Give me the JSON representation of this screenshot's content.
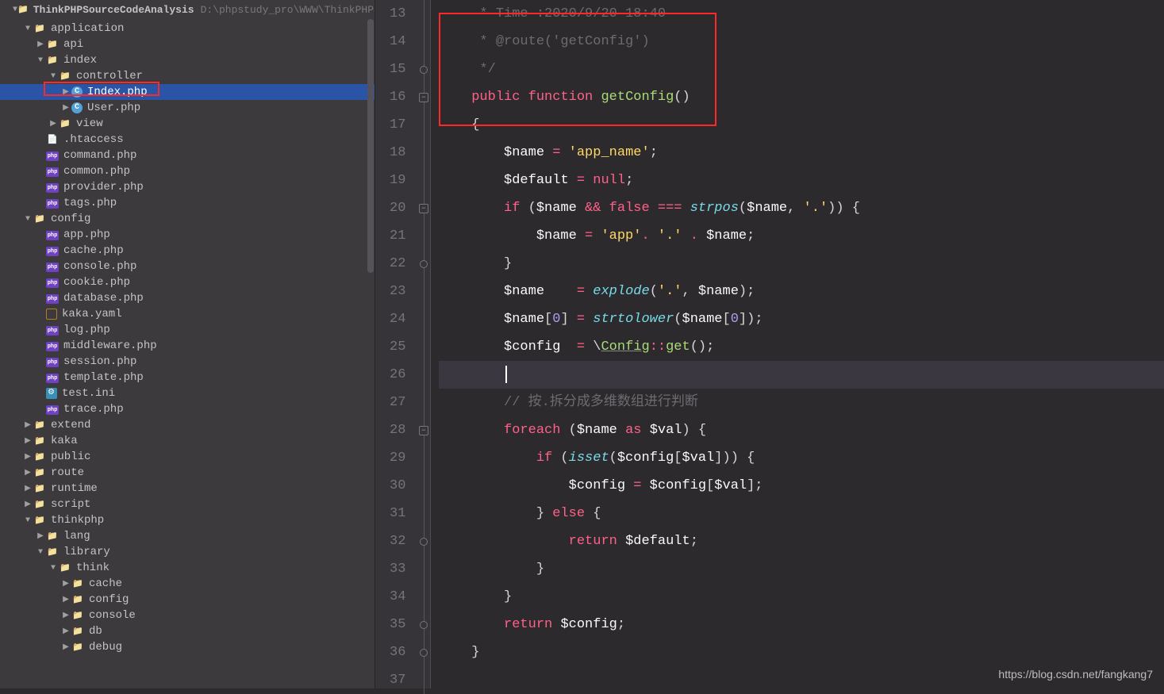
{
  "project": {
    "name": "ThinkPHPSourceCodeAnalysis",
    "path": "D:\\phpstudy_pro\\WWW\\ThinkPHPSourceCo"
  },
  "tree": [
    {
      "d": 1,
      "a": "d",
      "i": "folder",
      "t": "application"
    },
    {
      "d": 2,
      "a": "r",
      "i": "folder",
      "t": "api"
    },
    {
      "d": 2,
      "a": "d",
      "i": "folder",
      "t": "index"
    },
    {
      "d": 3,
      "a": "d",
      "i": "folder",
      "t": "controller"
    },
    {
      "d": 4,
      "a": "r",
      "i": "class",
      "t": "Index.php",
      "sel": true
    },
    {
      "d": 4,
      "a": "r",
      "i": "class",
      "t": "User.php"
    },
    {
      "d": 3,
      "a": "r",
      "i": "folder",
      "t": "view"
    },
    {
      "d": 2,
      "a": "n",
      "i": "file",
      "t": ".htaccess"
    },
    {
      "d": 2,
      "a": "n",
      "i": "php",
      "t": "command.php"
    },
    {
      "d": 2,
      "a": "n",
      "i": "php",
      "t": "common.php"
    },
    {
      "d": 2,
      "a": "n",
      "i": "php",
      "t": "provider.php"
    },
    {
      "d": 2,
      "a": "n",
      "i": "php",
      "t": "tags.php"
    },
    {
      "d": 1,
      "a": "d",
      "i": "folder",
      "t": "config"
    },
    {
      "d": 2,
      "a": "n",
      "i": "php",
      "t": "app.php"
    },
    {
      "d": 2,
      "a": "n",
      "i": "php",
      "t": "cache.php"
    },
    {
      "d": 2,
      "a": "n",
      "i": "php",
      "t": "console.php"
    },
    {
      "d": 2,
      "a": "n",
      "i": "php",
      "t": "cookie.php"
    },
    {
      "d": 2,
      "a": "n",
      "i": "php",
      "t": "database.php"
    },
    {
      "d": 2,
      "a": "n",
      "i": "yaml",
      "t": "kaka.yaml"
    },
    {
      "d": 2,
      "a": "n",
      "i": "php",
      "t": "log.php"
    },
    {
      "d": 2,
      "a": "n",
      "i": "php",
      "t": "middleware.php"
    },
    {
      "d": 2,
      "a": "n",
      "i": "php",
      "t": "session.php"
    },
    {
      "d": 2,
      "a": "n",
      "i": "php",
      "t": "template.php"
    },
    {
      "d": 2,
      "a": "n",
      "i": "ini",
      "t": "test.ini"
    },
    {
      "d": 2,
      "a": "n",
      "i": "php",
      "t": "trace.php"
    },
    {
      "d": 1,
      "a": "r",
      "i": "folder",
      "t": "extend"
    },
    {
      "d": 1,
      "a": "r",
      "i": "folder",
      "t": "kaka"
    },
    {
      "d": 1,
      "a": "r",
      "i": "folder",
      "t": "public"
    },
    {
      "d": 1,
      "a": "r",
      "i": "folder",
      "t": "route"
    },
    {
      "d": 1,
      "a": "r",
      "i": "folder",
      "t": "runtime"
    },
    {
      "d": 1,
      "a": "r",
      "i": "folder",
      "t": "script"
    },
    {
      "d": 1,
      "a": "d",
      "i": "folder",
      "t": "thinkphp"
    },
    {
      "d": 2,
      "a": "r",
      "i": "folder",
      "t": "lang"
    },
    {
      "d": 2,
      "a": "d",
      "i": "folder",
      "t": "library"
    },
    {
      "d": 3,
      "a": "d",
      "i": "folder",
      "t": "think"
    },
    {
      "d": 4,
      "a": "r",
      "i": "folder",
      "t": "cache"
    },
    {
      "d": 4,
      "a": "r",
      "i": "folder",
      "t": "config"
    },
    {
      "d": 4,
      "a": "r",
      "i": "folder",
      "t": "console"
    },
    {
      "d": 4,
      "a": "r",
      "i": "folder",
      "t": "db"
    },
    {
      "d": 4,
      "a": "r",
      "i": "folder",
      "t": "debug"
    }
  ],
  "lines": [
    13,
    14,
    15,
    16,
    17,
    18,
    19,
    20,
    21,
    22,
    23,
    24,
    25,
    26,
    27,
    28,
    29,
    30,
    31,
    32,
    33,
    34,
    35,
    36,
    37
  ],
  "fold": [
    "",
    "",
    "e",
    "m",
    "",
    "",
    "",
    "m",
    "",
    "e",
    "",
    "",
    "",
    "",
    "",
    "m",
    "",
    "",
    "",
    "e",
    "",
    "",
    "e",
    "e",
    ""
  ],
  "code": [
    {
      "tokens": [
        [
          "cm",
          "     * Time :2020/9/20 18:40"
        ]
      ]
    },
    {
      "tokens": [
        [
          "cm",
          "     * @route('getConfig')"
        ]
      ]
    },
    {
      "tokens": [
        [
          "cm",
          "     */"
        ]
      ]
    },
    {
      "tokens": [
        [
          "pn",
          "    "
        ],
        [
          "kw",
          "public"
        ],
        [
          "pn",
          " "
        ],
        [
          "kw",
          "function"
        ],
        [
          "pn",
          " "
        ],
        [
          "fn",
          "getConfig"
        ],
        [
          "pn",
          "()"
        ]
      ]
    },
    {
      "tokens": [
        [
          "pn",
          "    {"
        ]
      ]
    },
    {
      "tokens": [
        [
          "pn",
          "        "
        ],
        [
          "var",
          "$name"
        ],
        [
          "pn",
          " "
        ],
        [
          "op",
          "="
        ],
        [
          "pn",
          " "
        ],
        [
          "str",
          "'app_name'"
        ],
        [
          "pn",
          ";"
        ]
      ]
    },
    {
      "tokens": [
        [
          "pn",
          "        "
        ],
        [
          "var",
          "$default"
        ],
        [
          "pn",
          " "
        ],
        [
          "op",
          "="
        ],
        [
          "pn",
          " "
        ],
        [
          "kw",
          "null"
        ],
        [
          "pn",
          ";"
        ]
      ]
    },
    {
      "tokens": [
        [
          "pn",
          "        "
        ],
        [
          "kw",
          "if"
        ],
        [
          "pn",
          " ("
        ],
        [
          "var",
          "$name"
        ],
        [
          "pn",
          " "
        ],
        [
          "op",
          "&&"
        ],
        [
          "pn",
          " "
        ],
        [
          "kw",
          "false"
        ],
        [
          "pn",
          " "
        ],
        [
          "op",
          "==="
        ],
        [
          "pn",
          " "
        ],
        [
          "builtin",
          "strpos"
        ],
        [
          "pn",
          "("
        ],
        [
          "var",
          "$name"
        ],
        [
          "pn",
          ", "
        ],
        [
          "str",
          "'.'"
        ],
        [
          "pn",
          ")) {"
        ]
      ]
    },
    {
      "tokens": [
        [
          "pn",
          "            "
        ],
        [
          "var",
          "$name"
        ],
        [
          "pn",
          " "
        ],
        [
          "op",
          "="
        ],
        [
          "pn",
          " "
        ],
        [
          "str",
          "'app'"
        ],
        [
          "op",
          "."
        ],
        [
          "pn",
          " "
        ],
        [
          "str",
          "'.'"
        ],
        [
          "pn",
          " "
        ],
        [
          "op",
          "."
        ],
        [
          "pn",
          " "
        ],
        [
          "var",
          "$name"
        ],
        [
          "pn",
          ";"
        ]
      ]
    },
    {
      "tokens": [
        [
          "pn",
          "        }"
        ]
      ]
    },
    {
      "tokens": [
        [
          "pn",
          "        "
        ],
        [
          "var",
          "$name"
        ],
        [
          "pn",
          "    "
        ],
        [
          "op",
          "="
        ],
        [
          "pn",
          " "
        ],
        [
          "builtin",
          "explode"
        ],
        [
          "pn",
          "("
        ],
        [
          "str",
          "'.'"
        ],
        [
          "pn",
          ", "
        ],
        [
          "var",
          "$name"
        ],
        [
          "pn",
          ");"
        ]
      ]
    },
    {
      "tokens": [
        [
          "pn",
          "        "
        ],
        [
          "var",
          "$name"
        ],
        [
          "pn",
          "["
        ],
        [
          "num",
          "0"
        ],
        [
          "pn",
          "] "
        ],
        [
          "op",
          "="
        ],
        [
          "pn",
          " "
        ],
        [
          "builtin",
          "strtolower"
        ],
        [
          "pn",
          "("
        ],
        [
          "var",
          "$name"
        ],
        [
          "pn",
          "["
        ],
        [
          "num",
          "0"
        ],
        [
          "pn",
          "]);"
        ]
      ]
    },
    {
      "tokens": [
        [
          "pn",
          "        "
        ],
        [
          "var",
          "$config"
        ],
        [
          "pn",
          "  "
        ],
        [
          "op",
          "="
        ],
        [
          "pn",
          " \\"
        ],
        [
          "fn underline",
          "Config"
        ],
        [
          "op",
          "::"
        ],
        [
          "fn",
          "get"
        ],
        [
          "pn",
          "();"
        ]
      ]
    },
    {
      "tokens": [
        [
          "pn",
          "        "
        ]
      ],
      "current": true,
      "caret": true
    },
    {
      "tokens": [
        [
          "pn",
          "        "
        ],
        [
          "cm",
          "// 按.拆分成多维数组进行判断"
        ]
      ]
    },
    {
      "tokens": [
        [
          "pn",
          "        "
        ],
        [
          "kw",
          "foreach"
        ],
        [
          "pn",
          " ("
        ],
        [
          "var",
          "$name"
        ],
        [
          "pn",
          " "
        ],
        [
          "kw",
          "as"
        ],
        [
          "pn",
          " "
        ],
        [
          "var",
          "$val"
        ],
        [
          "pn",
          ") {"
        ]
      ]
    },
    {
      "tokens": [
        [
          "pn",
          "            "
        ],
        [
          "kw",
          "if"
        ],
        [
          "pn",
          " ("
        ],
        [
          "builtin",
          "isset"
        ],
        [
          "pn",
          "("
        ],
        [
          "var",
          "$config"
        ],
        [
          "pn",
          "["
        ],
        [
          "var",
          "$val"
        ],
        [
          "pn",
          "])) {"
        ]
      ]
    },
    {
      "tokens": [
        [
          "pn",
          "                "
        ],
        [
          "var",
          "$config"
        ],
        [
          "pn",
          " "
        ],
        [
          "op",
          "="
        ],
        [
          "pn",
          " "
        ],
        [
          "var",
          "$config"
        ],
        [
          "pn",
          "["
        ],
        [
          "var",
          "$val"
        ],
        [
          "pn",
          "];"
        ]
      ]
    },
    {
      "tokens": [
        [
          "pn",
          "            } "
        ],
        [
          "kw",
          "else"
        ],
        [
          "pn",
          " {"
        ]
      ]
    },
    {
      "tokens": [
        [
          "pn",
          "                "
        ],
        [
          "kw",
          "return"
        ],
        [
          "pn",
          " "
        ],
        [
          "var",
          "$default"
        ],
        [
          "pn",
          ";"
        ]
      ]
    },
    {
      "tokens": [
        [
          "pn",
          "            }"
        ]
      ]
    },
    {
      "tokens": [
        [
          "pn",
          "        }"
        ]
      ]
    },
    {
      "tokens": [
        [
          "pn",
          "        "
        ],
        [
          "kw",
          "return"
        ],
        [
          "pn",
          " "
        ],
        [
          "var",
          "$config"
        ],
        [
          "pn",
          ";"
        ]
      ]
    },
    {
      "tokens": [
        [
          "pn",
          "    }"
        ]
      ]
    },
    {
      "tokens": [
        [
          "pn",
          ""
        ]
      ]
    }
  ],
  "watermark": "https://blog.csdn.net/fangkang7"
}
